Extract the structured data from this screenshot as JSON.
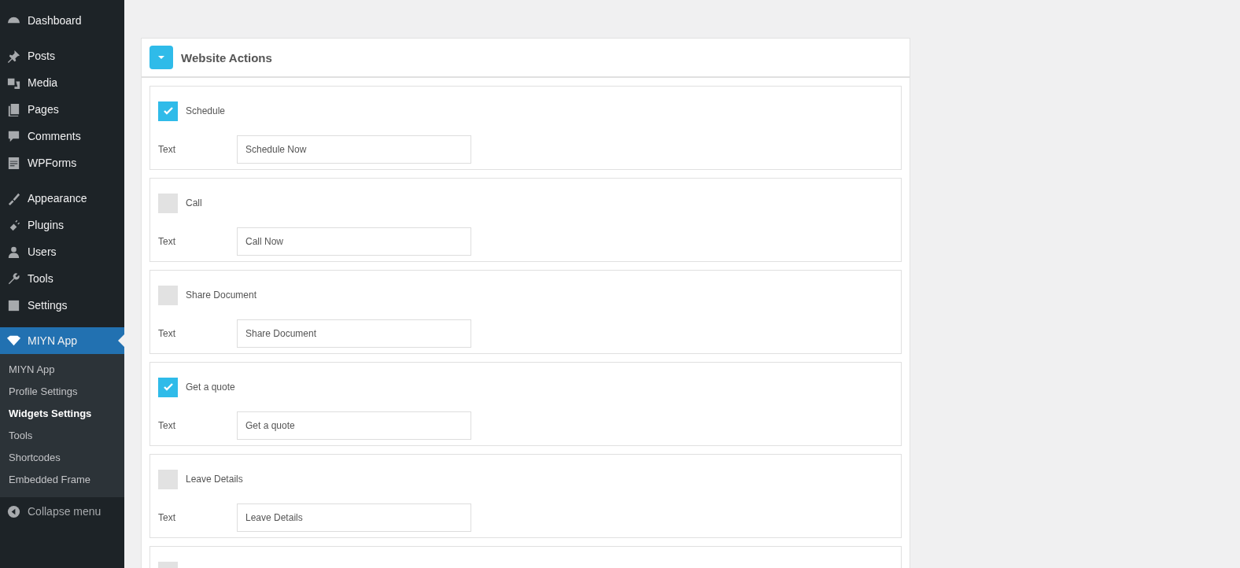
{
  "sidebar": {
    "groups": [
      [
        {
          "label": "Dashboard"
        }
      ],
      [
        {
          "label": "Posts"
        },
        {
          "label": "Media"
        },
        {
          "label": "Pages"
        },
        {
          "label": "Comments"
        },
        {
          "label": "WPForms"
        }
      ],
      [
        {
          "label": "Appearance"
        },
        {
          "label": "Plugins"
        },
        {
          "label": "Users"
        },
        {
          "label": "Tools"
        },
        {
          "label": "Settings"
        }
      ]
    ],
    "active_item": {
      "label": "MIYN App",
      "expanded": true
    },
    "submenu": [
      {
        "label": "MIYN App",
        "selected": false
      },
      {
        "label": "Profile Settings",
        "selected": false
      },
      {
        "label": "Widgets Settings",
        "selected": true
      },
      {
        "label": "Tools",
        "selected": false
      },
      {
        "label": "Shortcodes",
        "selected": false
      },
      {
        "label": "Embedded Frame",
        "selected": false
      }
    ],
    "collapse": "Collapse menu"
  },
  "panel": {
    "title": "Website Actions",
    "expanded": true,
    "actions": [
      {
        "label": "Schedule",
        "checked": true,
        "field_label": "Text",
        "value": "Schedule Now"
      },
      {
        "label": "Call",
        "checked": false,
        "field_label": "Text",
        "value": "Call Now"
      },
      {
        "label": "Share Document",
        "checked": false,
        "field_label": "Text",
        "value": "Share Document"
      },
      {
        "label": "Get a quote",
        "checked": true,
        "field_label": "Text",
        "value": "Get a quote"
      },
      {
        "label": "Leave Details",
        "checked": false,
        "field_label": "Text",
        "value": "Leave Details"
      },
      {
        "checked": false
      }
    ]
  }
}
